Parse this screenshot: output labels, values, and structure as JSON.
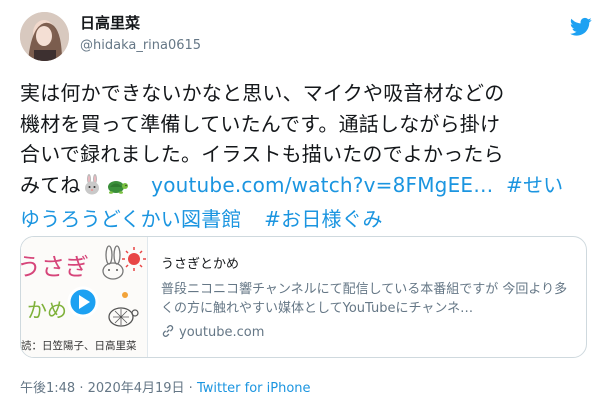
{
  "user": {
    "name": "日高里菜",
    "handle": "@hidaka_rina0615",
    "avatar_icon": "profile-photo"
  },
  "tweet": {
    "line1": "実は何かできないかなと思い、マイクや吸音材などの",
    "line2": "機材を買って準備していたんです。通話しながら掛け",
    "line3": "合いで録れました。イラストも描いたのでよかったら",
    "line4_text": "みてね",
    "line4_emoji": [
      "rabbit-emoji",
      "turtle-emoji"
    ],
    "line4_link": "youtube.com/watch?v=8FMgEE…",
    "line4_hashtag": "#せい",
    "line5_hashtag": "ゆうろうどくかい図書館",
    "line5_hashtag2": "#お日様ぐみ"
  },
  "card": {
    "title": "うさぎとかめ",
    "description": "普段ニコニコ響チャンネルにて配信している本番組ですが 今回より多くの方に触れやすい媒体としてYouTubeにチャンネ…",
    "domain": "youtube.com",
    "thumbnail": {
      "title_text": "うさぎ",
      "subtitle_text": "かめ",
      "credit_text": "読：日笠陽子、日高里菜"
    }
  },
  "meta": {
    "time": "午後1:48",
    "separator1": "·",
    "date": "2020年4月19日",
    "separator2": "·",
    "source": "Twitter for iPhone"
  },
  "colors": {
    "link": "#1b95e0",
    "secondary_text": "#657786",
    "twitter_blue": "#1da1f2",
    "play_button": "#1da1f2"
  }
}
